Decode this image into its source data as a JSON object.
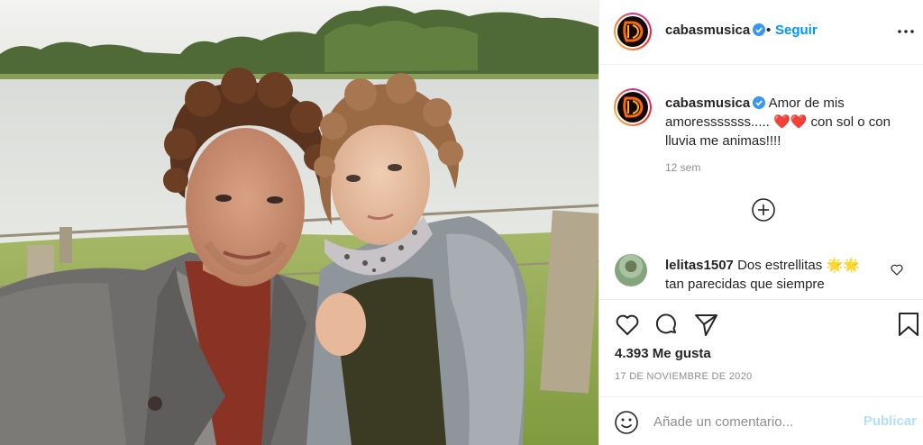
{
  "post": {
    "image_alt": "Man and child selfie by a lake",
    "author": "cabasmusica",
    "verified": true,
    "follow_label": "Seguir",
    "header_dot": "•",
    "caption_text_1": "Amor de mis amoresssssss..... ",
    "caption_hearts": "❤️❤️",
    "caption_text_2": " con sol o con lluvia me animas!!!!",
    "time_ago": "12 sem"
  },
  "comments": [
    {
      "username": "lelitas1507",
      "text": "Dos estrellitas 🌟🌟 tan parecidas que siempre"
    }
  ],
  "actions": {
    "likes": "4.393 Me gusta",
    "date": "17 DE NOVIEMBRE DE 2020"
  },
  "comment_box": {
    "placeholder": "Añade un comentario...",
    "publish_label": "Publicar"
  },
  "icons": {
    "verified": "verified-badge-icon",
    "more": "more-options-icon",
    "load_more": "plus-circle-icon",
    "like": "heart-icon",
    "comment": "comment-bubble-icon",
    "share": "paper-plane-icon",
    "save": "bookmark-icon",
    "emoji": "smiley-icon"
  },
  "colors": {
    "accent_blue": "#0095f6",
    "publish_disabled": "#b2dffc",
    "secondary_text": "#8e8e8e",
    "heart_red": "#e0102c"
  }
}
